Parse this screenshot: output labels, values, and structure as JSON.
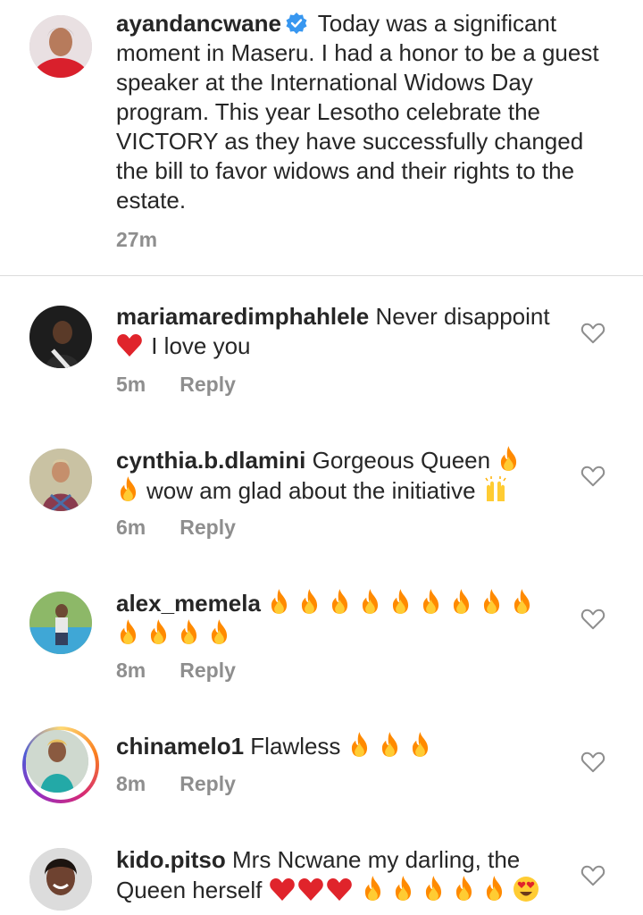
{
  "caption": {
    "username": "ayandancwane",
    "text": "Today was a significant moment in Maseru. I had a honor to be a guest speaker at the International Widows Day program. This year Lesotho celebrate the VICTORY as they have successfully changed the bill to favor widows and their rights to the estate.",
    "time": "27m"
  },
  "comments": [
    {
      "username": "mariamaredimphahlele",
      "text_a": "Never disappoint",
      "text_b": "I love you",
      "time": "5m",
      "reply": "Reply"
    },
    {
      "username": "cynthia.b.dlamini",
      "text_a": "Gorgeous Queen",
      "text_b": "wow am glad about the initiative",
      "time": "6m",
      "reply": "Reply"
    },
    {
      "username": "alex_memela",
      "time": "8m",
      "reply": "Reply"
    },
    {
      "username": "chinamelo1",
      "text_a": "Flawless",
      "time": "8m",
      "reply": "Reply"
    },
    {
      "username": "kido.pitso",
      "text_a": "Mrs Ncwane my darling, the Queen herself"
    }
  ],
  "icons": {
    "verified": "verified-badge-icon",
    "like": "heart-outline-icon",
    "fire": "fire-emoji",
    "red_heart": "red-heart-emoji",
    "raising_hands": "raising-hands-emoji",
    "heart_eyes": "heart-eyes-emoji"
  },
  "colors": {
    "verified": "#3897f0",
    "meta": "#8e8e8e",
    "divider": "#dbdbdb"
  }
}
